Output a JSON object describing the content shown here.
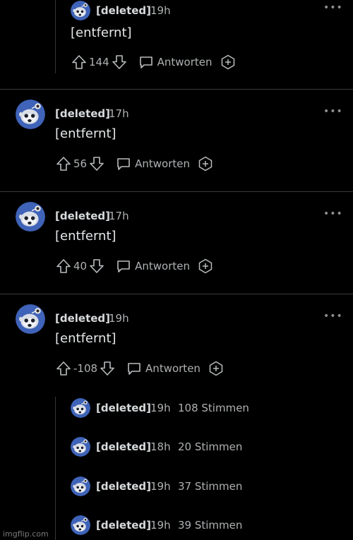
{
  "comments": [
    {
      "author": "[deleted]",
      "time": "19h",
      "body": "[entfernt]",
      "votes": "144",
      "reply_label": "Antworten"
    },
    {
      "author": "[deleted]",
      "time": "17h",
      "body": "[entfernt]",
      "votes": "56",
      "reply_label": "Antworten"
    },
    {
      "author": "[deleted]",
      "time": "17h",
      "body": "[entfernt]",
      "votes": "40",
      "reply_label": "Antworten"
    },
    {
      "author": "[deleted]",
      "time": "19h",
      "body": "[entfernt]",
      "votes": "-108",
      "reply_label": "Antworten"
    }
  ],
  "collapsed_replies": [
    {
      "author": "[deleted]",
      "time": "19h",
      "votes": "108 Stimmen"
    },
    {
      "author": "[deleted]",
      "time": "18h",
      "votes": "20 Stimmen"
    },
    {
      "author": "[deleted]",
      "time": "19h",
      "votes": "37 Stimmen"
    },
    {
      "author": "[deleted]",
      "time": "19h",
      "votes": "39 Stimmen"
    }
  ],
  "more_glyph": "•••",
  "watermark": "imgflip.com",
  "colors": {
    "background": "#000000",
    "text": "#d7dadc",
    "muted": "#aeb1b3",
    "avatar_blue": "#3f63b8"
  },
  "icons": {
    "upvote": "arrow-up-icon",
    "downvote": "arrow-down-icon",
    "reply": "speech-bubble-icon",
    "award": "award-icon",
    "avatar": "snoo-avatar-icon"
  }
}
